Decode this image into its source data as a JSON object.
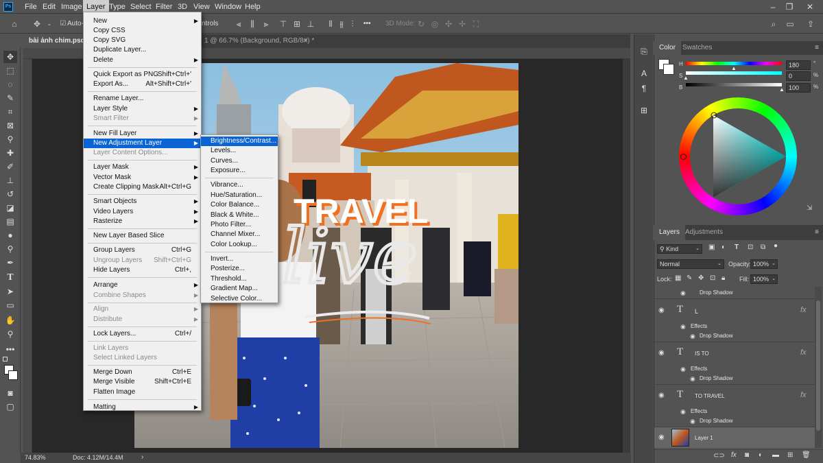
{
  "app": {
    "logo": "Ps"
  },
  "menubar": {
    "items": [
      "File",
      "Edit",
      "Image",
      "Layer",
      "Type",
      "Select",
      "Filter",
      "3D",
      "View",
      "Window",
      "Help"
    ],
    "window_controls": [
      "–",
      "❐",
      "✕"
    ]
  },
  "options": {
    "auto_select": "Auto-Se",
    "controls_suffix": "ntrols",
    "mode_3d": "3D Mode:",
    "more": "•••"
  },
  "tabs": {
    "doc1": "bài ảnh chim.psd @",
    "doc2": "1 @ 66.7% (Background, RGB/8#) *",
    "close": "×"
  },
  "status": {
    "zoom": "74.83%",
    "doc": "Doc: 4.12M/14.4M",
    "arrow": "›"
  },
  "artwork": {
    "title": "TRAVEL",
    "script": "live"
  },
  "layer_menu": {
    "groups": [
      [
        {
          "label": "New",
          "arrow": true
        },
        {
          "label": "Copy CSS"
        },
        {
          "label": "Copy SVG"
        },
        {
          "label": "Duplicate Layer..."
        },
        {
          "label": "Delete",
          "arrow": true
        }
      ],
      [
        {
          "label": "Quick Export as PNG",
          "sc": "Shift+Ctrl+'"
        },
        {
          "label": "Export As...",
          "sc": "Alt+Shift+Ctrl+'"
        }
      ],
      [
        {
          "label": "Rename Layer..."
        },
        {
          "label": "Layer Style",
          "arrow": true
        },
        {
          "label": "Smart Filter",
          "arrow": true,
          "dis": true
        }
      ],
      [
        {
          "label": "New Fill Layer",
          "arrow": true
        },
        {
          "label": "New Adjustment Layer",
          "arrow": true,
          "hl": true
        },
        {
          "label": "Layer Content Options...",
          "dis": true
        }
      ],
      [
        {
          "label": "Layer Mask",
          "arrow": true
        },
        {
          "label": "Vector Mask",
          "arrow": true
        },
        {
          "label": "Create Clipping Mask",
          "sc": "Alt+Ctrl+G"
        }
      ],
      [
        {
          "label": "Smart Objects",
          "arrow": true
        },
        {
          "label": "Video Layers",
          "arrow": true
        },
        {
          "label": "Rasterize",
          "arrow": true
        }
      ],
      [
        {
          "label": "New Layer Based Slice"
        }
      ],
      [
        {
          "label": "Group Layers",
          "sc": "Ctrl+G"
        },
        {
          "label": "Ungroup Layers",
          "sc": "Shift+Ctrl+G",
          "dis": true
        },
        {
          "label": "Hide Layers",
          "sc": "Ctrl+,"
        }
      ],
      [
        {
          "label": "Arrange",
          "arrow": true
        },
        {
          "label": "Combine Shapes",
          "arrow": true,
          "dis": true
        }
      ],
      [
        {
          "label": "Align",
          "arrow": true,
          "dis": true
        },
        {
          "label": "Distribute",
          "arrow": true,
          "dis": true
        }
      ],
      [
        {
          "label": "Lock Layers...",
          "sc": "Ctrl+/"
        }
      ],
      [
        {
          "label": "Link Layers",
          "dis": true
        },
        {
          "label": "Select Linked Layers",
          "dis": true
        }
      ],
      [
        {
          "label": "Merge Down",
          "sc": "Ctrl+E"
        },
        {
          "label": "Merge Visible",
          "sc": "Shift+Ctrl+E"
        },
        {
          "label": "Flatten Image"
        }
      ],
      [
        {
          "label": "Matting",
          "arrow": true
        }
      ]
    ]
  },
  "adjust_menu": {
    "groups": [
      [
        "Brightness/Contrast...",
        "Levels...",
        "Curves...",
        "Exposure..."
      ],
      [
        "Vibrance...",
        "Hue/Saturation...",
        "Color Balance...",
        "Black & White...",
        "Photo Filter...",
        "Channel Mixer...",
        "Color Lookup..."
      ],
      [
        "Invert...",
        "Posterize...",
        "Threshold...",
        "Gradient Map...",
        "Selective Color..."
      ]
    ]
  },
  "color_panel": {
    "tabs": [
      "Color",
      "Swatches"
    ],
    "labels": {
      "h": "H",
      "s": "S",
      "b": "B"
    },
    "values": {
      "h": "180",
      "s": "0",
      "b": "100"
    },
    "units": {
      "h": "°",
      "s": "%",
      "b": "%"
    },
    "levels": {
      "h": 0.5,
      "s": 0.0,
      "b": 1.0
    }
  },
  "layers_panel": {
    "tabs": [
      "Layers",
      "Adjustments"
    ],
    "filter": "Kind",
    "blend": "Normal",
    "opacity_label": "Opacity:",
    "opacity": "100%",
    "lock_label": "Lock:",
    "fill_label": "Fill:",
    "fill": "100%",
    "top_effect": "Drop Shadow",
    "layers": [
      {
        "name": "L",
        "effects": "Effects",
        "effect": "Drop Shadow",
        "fx": "fx"
      },
      {
        "name": "IS TO",
        "effects": "Effects",
        "effect": "Drop Shadow",
        "fx": "fx"
      },
      {
        "name": "TO TRAVEL",
        "effects": "Effects",
        "effect": "Drop Shadow",
        "fx": "fx"
      }
    ],
    "image_layer": "Layer 1"
  },
  "colors": {
    "highlight": "#0b64d3",
    "accent": "#f07020"
  }
}
